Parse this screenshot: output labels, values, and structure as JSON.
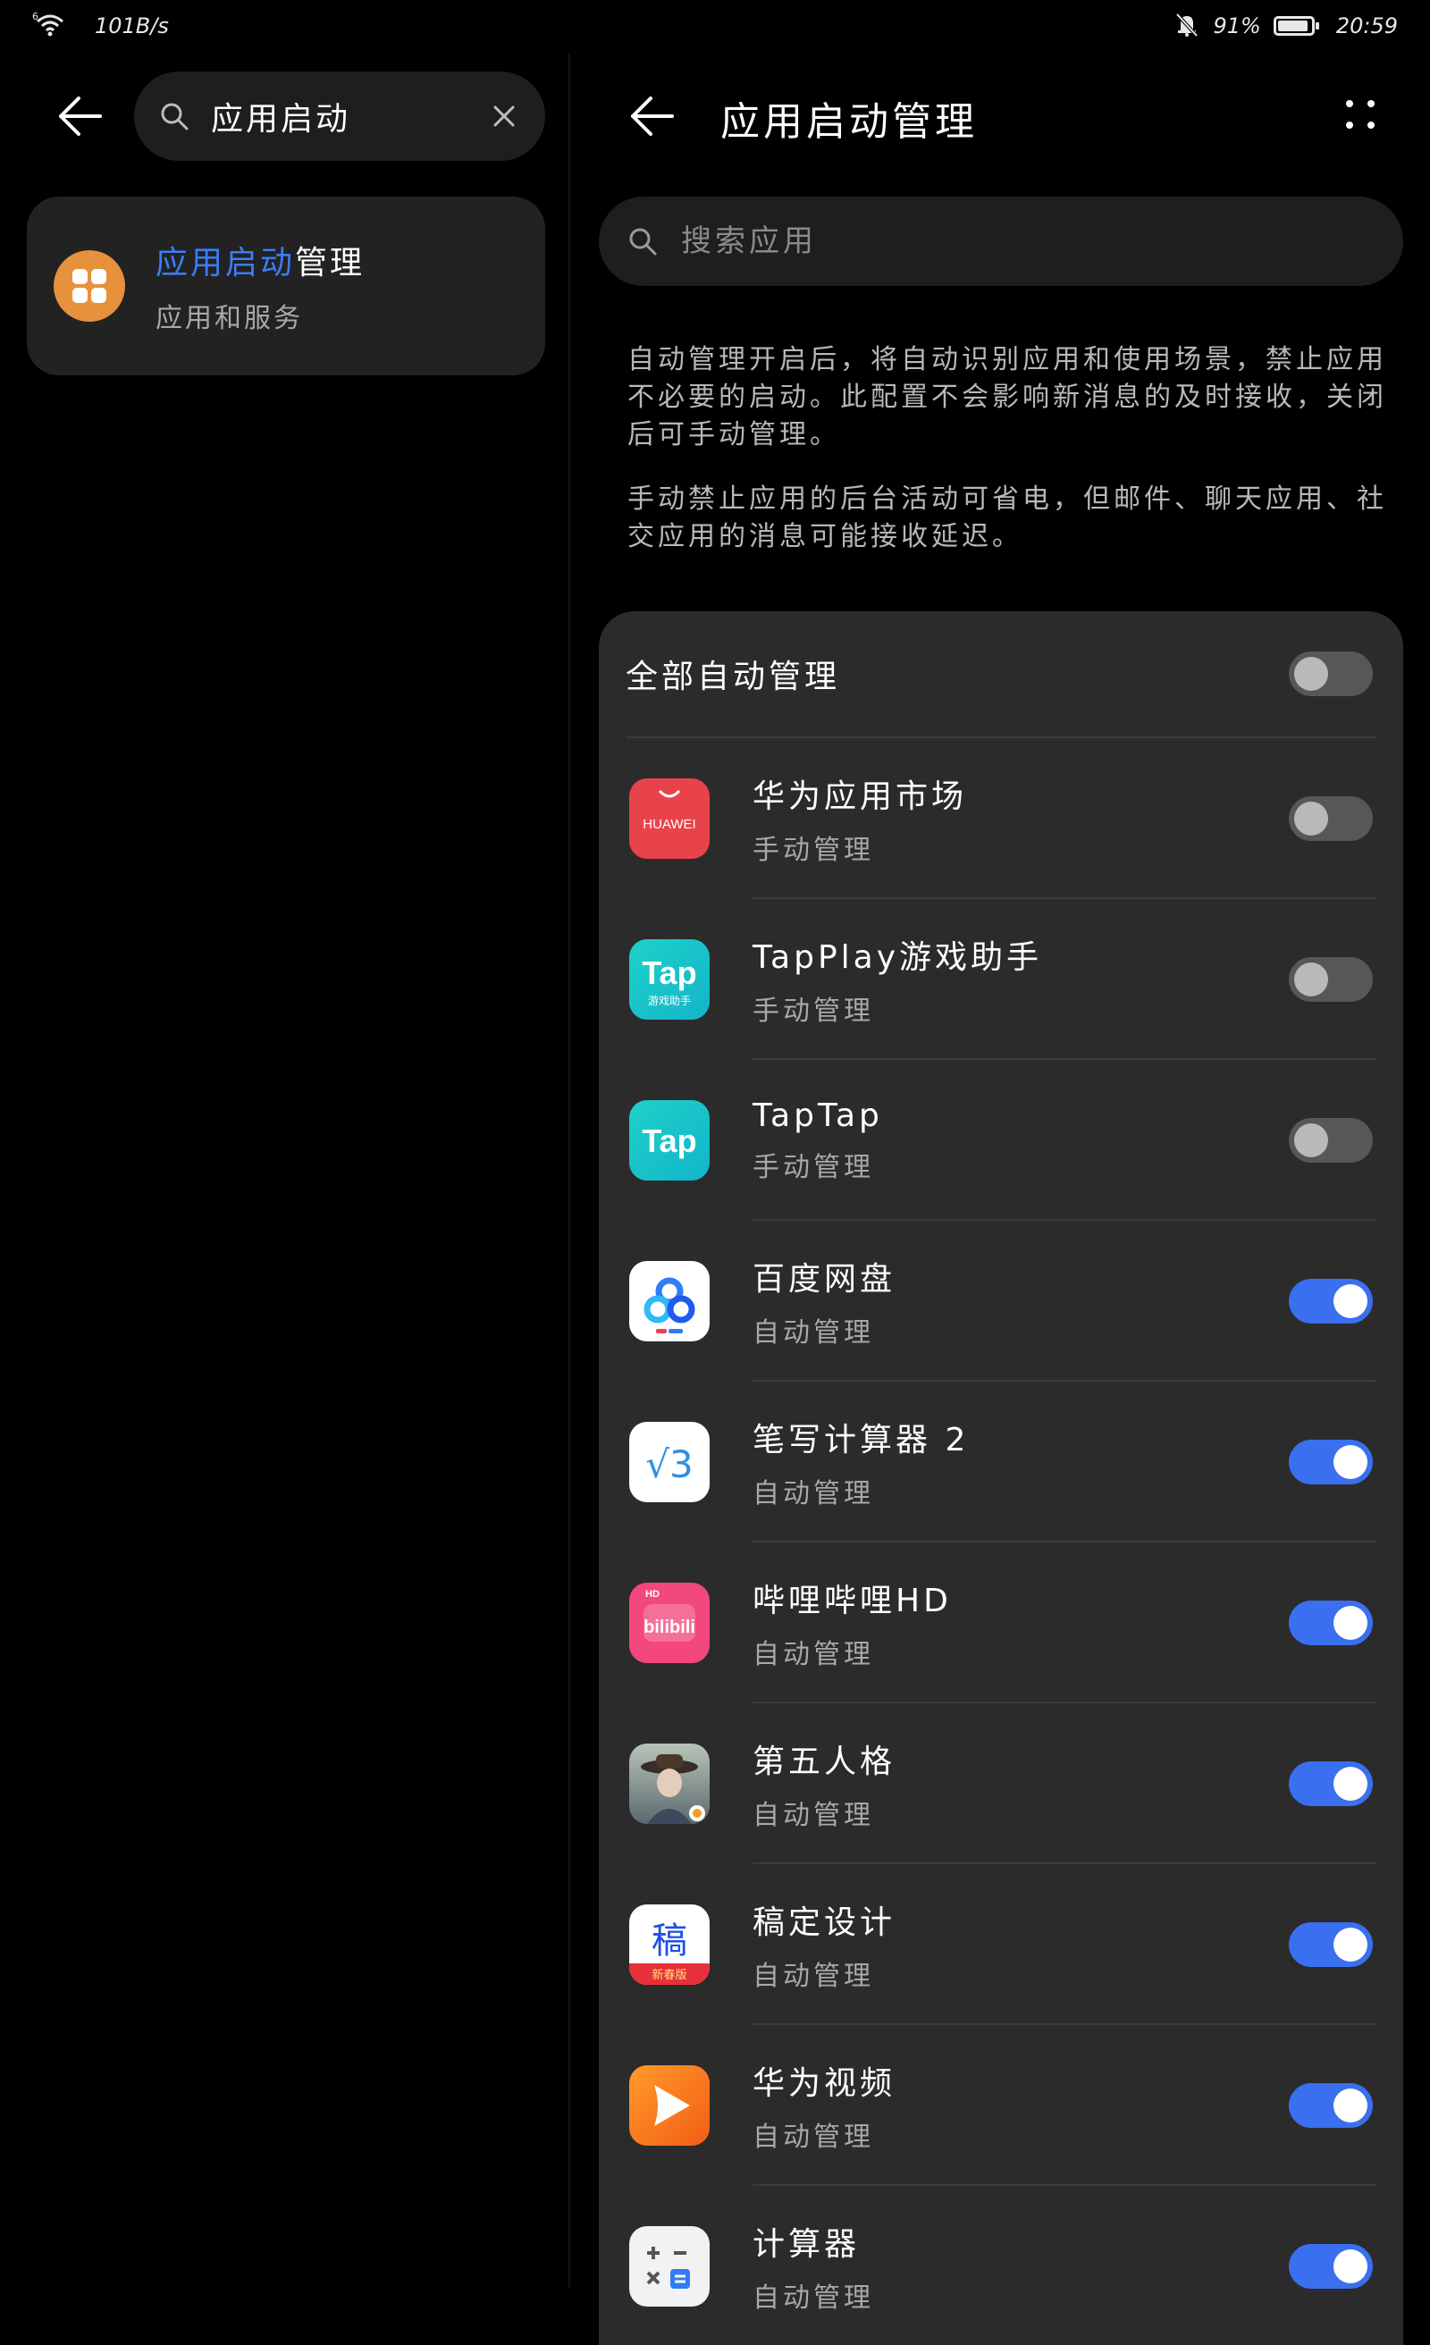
{
  "status_bar": {
    "signal_label": "6",
    "net_speed": "101B/s",
    "battery_percent": "91%",
    "time": "20:59",
    "battery_level": 0.91
  },
  "left": {
    "search_query": "应用启动",
    "result": {
      "title_highlight": "应用启动",
      "title_rest": "管理",
      "subtitle": "应用和服务",
      "icon": "apps-icon",
      "icon_color": "#e6913c"
    }
  },
  "right": {
    "title": "应用启动管理",
    "search_placeholder": "搜索应用",
    "desc1": "自动管理开启后，将自动识别应用和使用场景，禁止应用不必要的启动。此配置不会影响新消息的及时接收，关闭后可手动管理。",
    "desc2": "手动禁止应用的后台活动可省电，但邮件、聊天应用、社交应用的消息可能接收延迟。",
    "all_label": "全部自动管理",
    "all_enabled": false,
    "apps": [
      {
        "name": "华为应用市场",
        "status": "手动管理",
        "enabled": false,
        "icon": "huawei-appgallery-icon",
        "icon_text": "HUAWEI"
      },
      {
        "name": "TapPlay游戏助手",
        "status": "手动管理",
        "enabled": false,
        "icon": "tapplay-icon",
        "icon_text": "Tap",
        "icon_sub": "游戏助手"
      },
      {
        "name": "TapTap",
        "status": "手动管理",
        "enabled": false,
        "icon": "taptap-icon",
        "icon_text": "Tap"
      },
      {
        "name": "百度网盘",
        "status": "自动管理",
        "enabled": true,
        "icon": "baidu-netdisk-icon"
      },
      {
        "name": "笔写计算器 2",
        "status": "自动管理",
        "enabled": true,
        "icon": "pen-calculator-icon",
        "icon_text": "√3"
      },
      {
        "name": "哔哩哔哩HD",
        "status": "自动管理",
        "enabled": true,
        "icon": "bilibili-hd-icon",
        "icon_text": "bilibili",
        "icon_badge": "HD"
      },
      {
        "name": "第五人格",
        "status": "自动管理",
        "enabled": true,
        "icon": "identity-v-icon"
      },
      {
        "name": "稿定设计",
        "status": "自动管理",
        "enabled": true,
        "icon": "gaoding-design-icon",
        "icon_text": "稿",
        "icon_sub": "新春版"
      },
      {
        "name": "华为视频",
        "status": "自动管理",
        "enabled": true,
        "icon": "huawei-video-icon"
      },
      {
        "name": "计算器",
        "status": "自动管理",
        "enabled": true,
        "icon": "calculator-icon"
      }
    ]
  },
  "colors": {
    "accent": "#3a6ff0",
    "highlight": "#3d7cf5",
    "background": "#000000",
    "card": "#2b2b2b"
  }
}
